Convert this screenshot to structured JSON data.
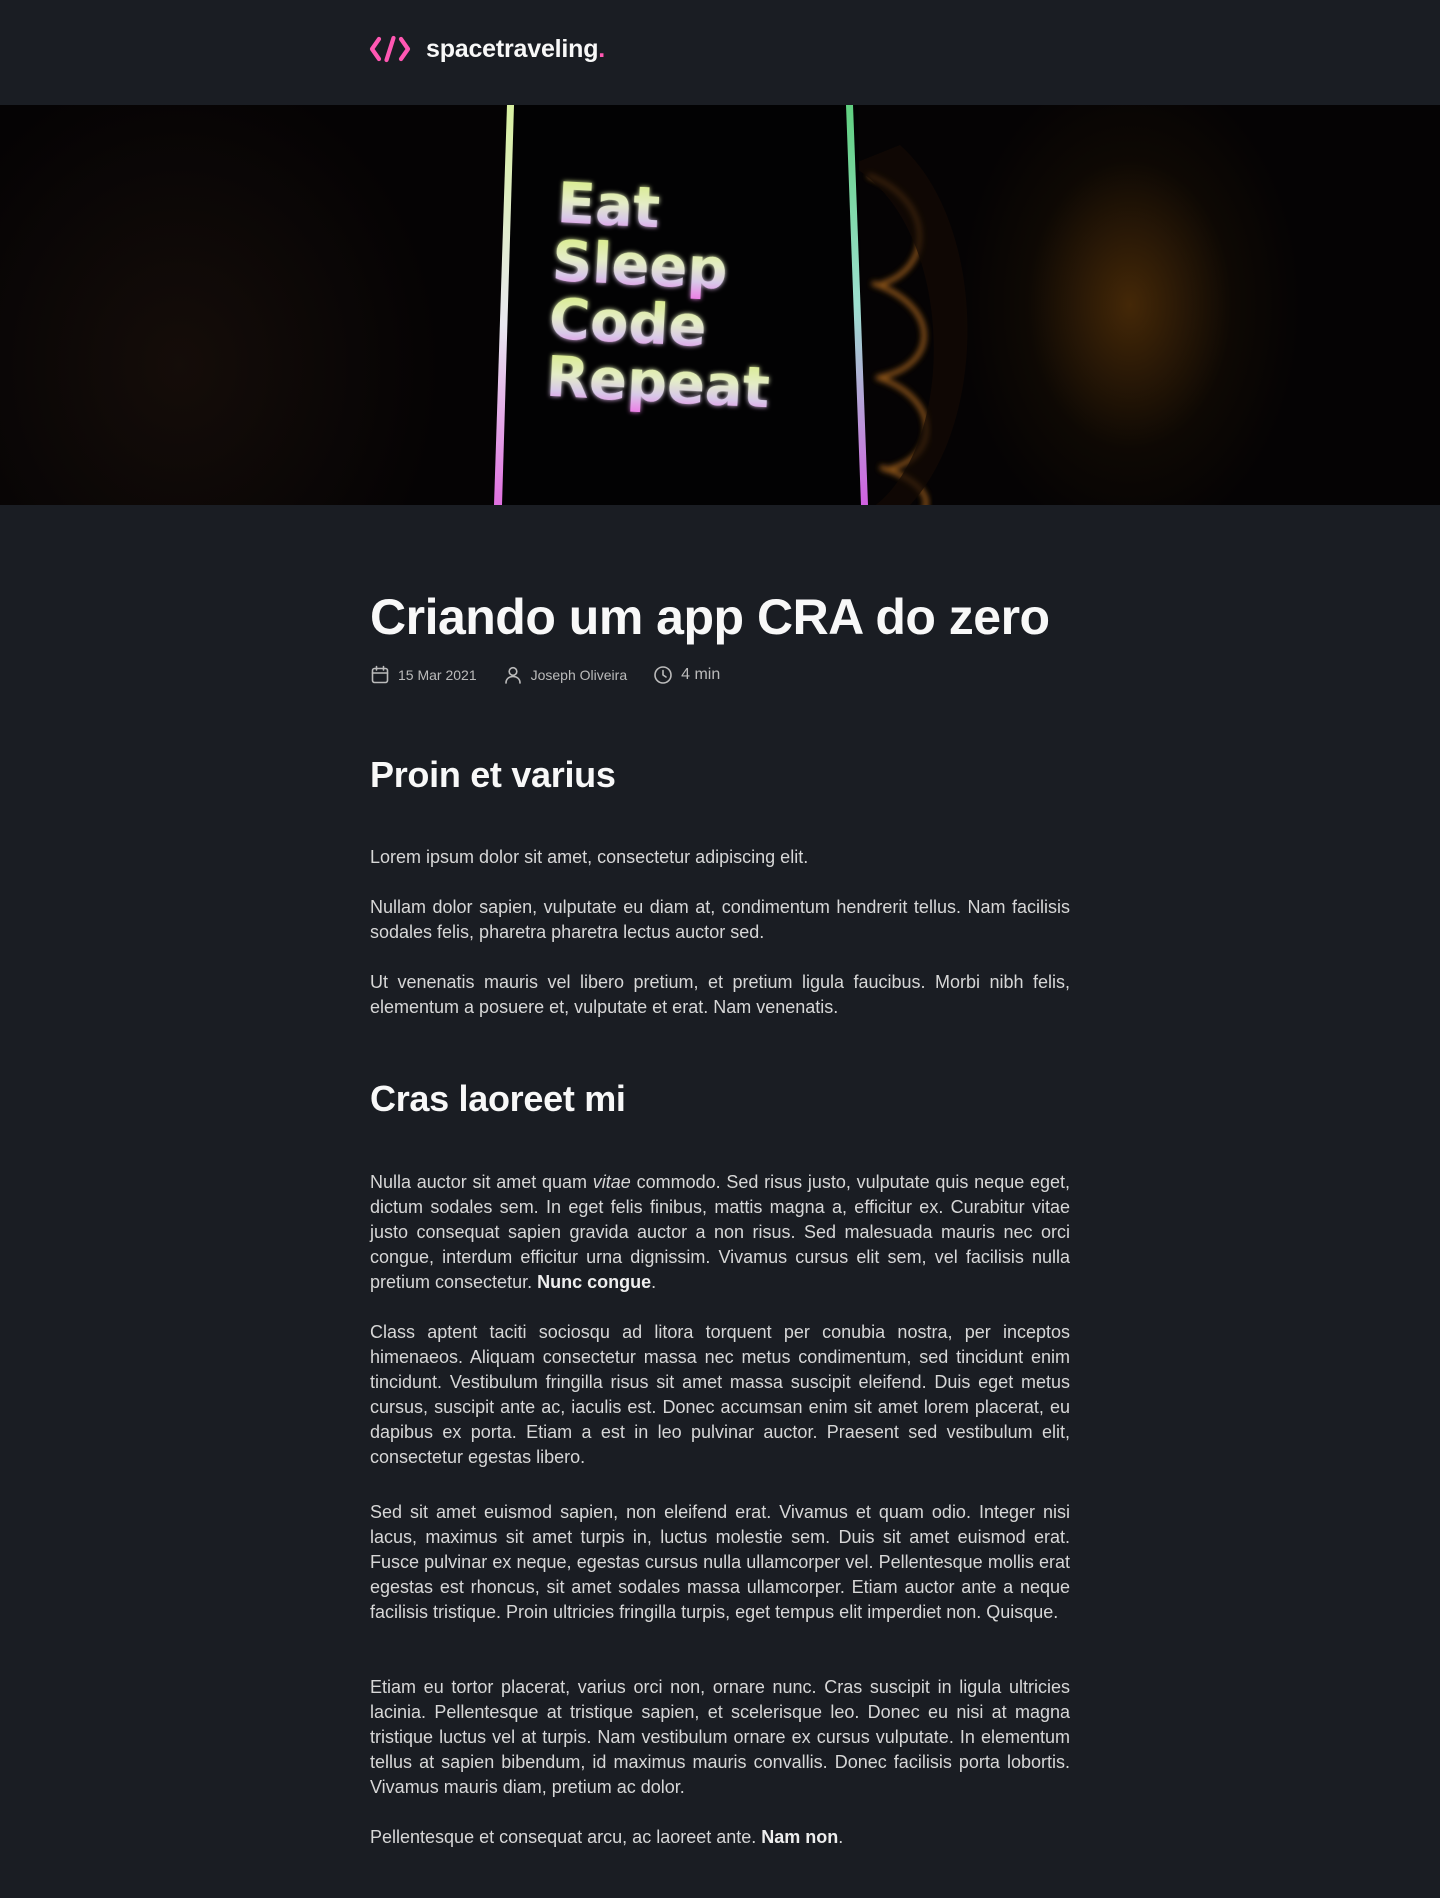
{
  "header": {
    "logo_text": "spacetraveling",
    "logo_dot": ".",
    "logo_icon": "code-brackets-icon"
  },
  "banner": {
    "image_alt": "phone screen with neon text",
    "lines": [
      "Eat",
      "Sleep",
      "Code",
      "Repeat"
    ]
  },
  "post": {
    "title": "Criando um app CRA do zero",
    "meta": {
      "date": "15 Mar 2021",
      "author": "Joseph Oliveira",
      "reading_time": "4 min"
    },
    "sections": [
      {
        "heading": "Proin et varius",
        "paragraphs": [
          "Lorem ipsum dolor sit amet, consectetur adipiscing elit.",
          "Nullam dolor sapien, vulputate eu diam at, condimentum hendrerit tellus. Nam facilisis sodales felis, pharetra pharetra lectus auctor sed.",
          "Ut venenatis mauris vel libero pretium, et pretium ligula faucibus. Morbi nibh felis, elementum a posuere et, vulputate et erat. Nam venenatis."
        ]
      },
      {
        "heading": "Cras laoreet mi",
        "p1_pre": "Nulla auctor sit amet quam ",
        "p1_em": "vitae",
        "p1_mid": " commodo. Sed risus justo, vulputate quis neque eget, dictum sodales sem. In eget felis finibus, mattis magna a, efficitur ex. Curabitur vitae justo consequat sapien gravida auctor a non risus. Sed malesuada mauris nec orci congue, interdum efficitur urna dignissim. Vivamus cursus elit sem, vel facilisis nulla pretium consectetur. ",
        "p1_bold": "Nunc congue",
        "p1_end": ".",
        "p2": "Class aptent taciti sociosqu ad litora torquent per conubia nostra, per inceptos himenaeos. Aliquam consectetur massa nec metus condimentum, sed tincidunt enim tincidunt. Vestibulum fringilla risus sit amet massa suscipit eleifend. Duis eget metus cursus, suscipit ante ac, iaculis est. Donec accumsan enim sit amet lorem placerat, eu dapibus ex porta. Etiam a est in leo pulvinar auctor. Praesent sed vestibulum elit, consectetur egestas libero.",
        "p3": "Sed sit amet euismod sapien, non eleifend erat. Vivamus et quam odio. Integer nisi lacus, maximus sit amet turpis in, luctus molestie sem. Duis sit amet euismod erat. Fusce pulvinar ex neque, egestas cursus nulla ullamcorper vel. Pellentesque mollis erat egestas est rhoncus, sit amet sodales massa ullamcorper. Etiam auctor ante a neque facilisis tristique. Proin ultricies fringilla turpis, eget tempus elit imperdiet non. Quisque.",
        "p4": "Etiam eu tortor placerat, varius orci non, ornare nunc. Cras suscipit in ligula ultricies lacinia. Pellentesque at tristique sapien, et scelerisque leo. Donec eu nisi at magna tristique luctus vel at turpis. Nam vestibulum ornare ex cursus vulputate. In elementum tellus at sapien bibendum, id maximus mauris convallis. Donec facilisis porta lobortis. Vivamus mauris diam, pretium ac dolor.",
        "p5_pre": "Pellentesque et consequat arcu, ac laoreet ante. ",
        "p5_bold": "Nam non",
        "p5_end": "."
      }
    ]
  },
  "colors": {
    "background": "#1a1d23",
    "accent": "#ff57b2",
    "heading": "#f8f8f8",
    "body_text": "#d7d7d7",
    "meta_text": "#bbbbbb"
  },
  "icons": {
    "date": "calendar-icon",
    "author": "user-icon",
    "time": "clock-icon"
  }
}
